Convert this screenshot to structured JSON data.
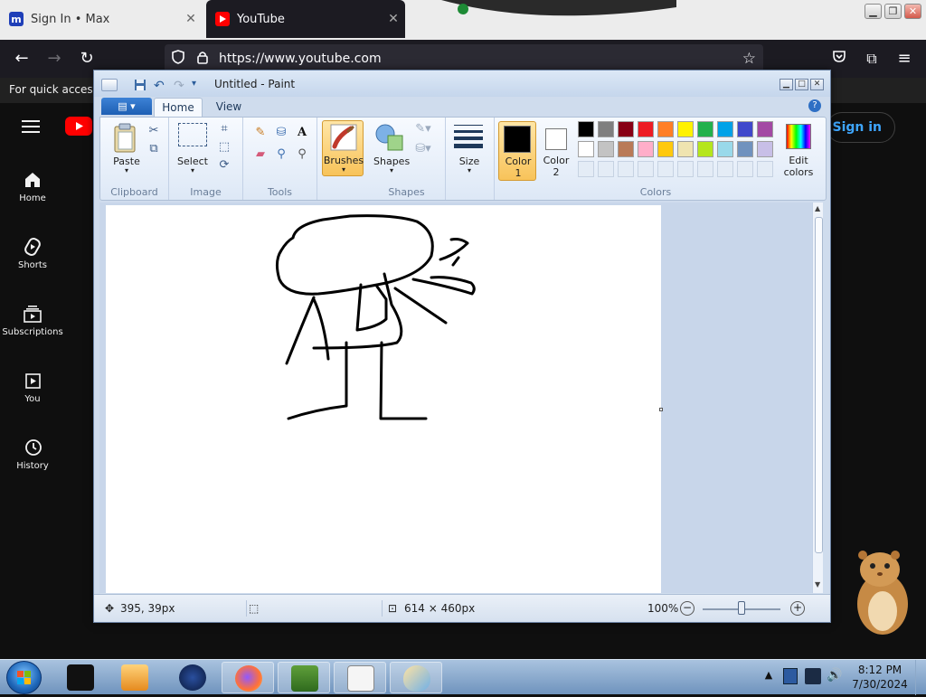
{
  "browser": {
    "tabs": [
      {
        "title": "Sign In • Max",
        "favicon": "max-icon"
      },
      {
        "title": "YouTube",
        "favicon": "youtube-icon",
        "active": true
      }
    ],
    "url": "https://www.youtube.com"
  },
  "youtube": {
    "banner": "For quick access,",
    "nav": [
      {
        "label": "Home",
        "icon": "home-icon"
      },
      {
        "label": "Shorts",
        "icon": "shorts-icon"
      },
      {
        "label": "Subscriptions",
        "icon": "subscriptions-icon"
      },
      {
        "label": "You",
        "icon": "you-icon"
      },
      {
        "label": "History",
        "icon": "history-icon"
      }
    ],
    "sign_in": "Sign in"
  },
  "paint": {
    "title": "Untitled - Paint",
    "tabs": {
      "home": "Home",
      "view": "View"
    },
    "groups": {
      "clipboard": "Clipboard",
      "image": "Image",
      "tools": "Tools",
      "shapes": "Shapes",
      "colors": "Colors"
    },
    "buttons": {
      "paste": "Paste",
      "select": "Select",
      "brushes": "Brushes",
      "shapes": "Shapes",
      "size": "Size",
      "color1_line1": "Color",
      "color1_line2": "1",
      "color2_line1": "Color",
      "color2_line2": "2",
      "edit_colors_line1": "Edit",
      "edit_colors_line2": "colors"
    },
    "palette_row1": [
      "#000000",
      "#7f7f7f",
      "#880015",
      "#ed1c24",
      "#ff7f27",
      "#fff200",
      "#22b14c",
      "#00a2e8",
      "#3f48cc",
      "#a349a4"
    ],
    "palette_row2": [
      "#ffffff",
      "#c3c3c3",
      "#b97a57",
      "#ffaec9",
      "#ffc90e",
      "#efe4b0",
      "#b5e61d",
      "#99d9ea",
      "#7092be",
      "#c8bfe7"
    ],
    "color1": "#000000",
    "color2": "#ffffff",
    "status": {
      "cursor_pos": "395, 39px",
      "canvas_size": "614 × 460px",
      "zoom": "100%"
    }
  },
  "taskbar": {
    "time": "8:12 PM",
    "date": "7/30/2024"
  }
}
